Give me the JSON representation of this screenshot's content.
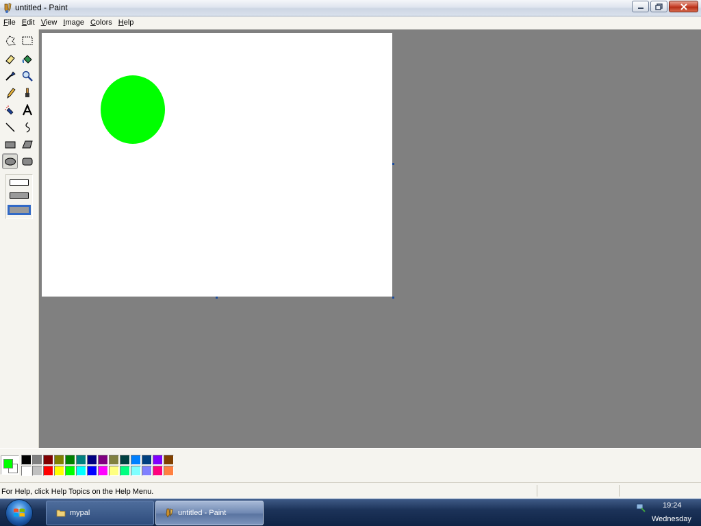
{
  "window": {
    "title": "untitled - Paint"
  },
  "menu": [
    {
      "u": "F",
      "rest": "ile"
    },
    {
      "u": "E",
      "rest": "dit"
    },
    {
      "u": "V",
      "rest": "iew"
    },
    {
      "u": "I",
      "rest": "mage"
    },
    {
      "u": "C",
      "rest": "olors"
    },
    {
      "u": "H",
      "rest": "elp"
    }
  ],
  "tools": [
    {
      "name": "free-form-select-tool",
      "icon": "free-form-select-icon",
      "selected": false
    },
    {
      "name": "select-tool",
      "icon": "select-icon",
      "selected": false
    },
    {
      "name": "eraser-tool",
      "icon": "eraser-icon",
      "selected": false
    },
    {
      "name": "fill-tool",
      "icon": "paint-bucket-icon",
      "selected": false
    },
    {
      "name": "pick-color-tool",
      "icon": "eyedropper-icon",
      "selected": false
    },
    {
      "name": "magnifier-tool",
      "icon": "magnifier-icon",
      "selected": false
    },
    {
      "name": "pencil-tool",
      "icon": "pencil-icon",
      "selected": false
    },
    {
      "name": "brush-tool",
      "icon": "brush-icon",
      "selected": false
    },
    {
      "name": "airbrush-tool",
      "icon": "airbrush-icon",
      "selected": false
    },
    {
      "name": "text-tool",
      "icon": "text-icon",
      "selected": false
    },
    {
      "name": "line-tool",
      "icon": "line-icon",
      "selected": false
    },
    {
      "name": "curve-tool",
      "icon": "curve-icon",
      "selected": false
    },
    {
      "name": "rectangle-tool",
      "icon": "rectangle-icon",
      "selected": false
    },
    {
      "name": "polygon-tool",
      "icon": "polygon-icon",
      "selected": false
    },
    {
      "name": "ellipse-tool",
      "icon": "ellipse-icon",
      "selected": true
    },
    {
      "name": "rounded-rectangle-tool",
      "icon": "rounded-rectangle-icon",
      "selected": false
    }
  ],
  "fill_options": [
    {
      "name": "outline-option",
      "style": "outline",
      "selected": false
    },
    {
      "name": "outline-fill-option",
      "style": "outline-fill",
      "selected": false
    },
    {
      "name": "fill-only-option",
      "style": "fill",
      "selected": true
    }
  ],
  "canvas": {
    "ellipse_color": "#00ff00"
  },
  "colors": {
    "foreground": "#00ff00",
    "background": "#ffffff",
    "palette": [
      "#000000",
      "#808080",
      "#800000",
      "#808000",
      "#008000",
      "#008080",
      "#000080",
      "#800080",
      "#808040",
      "#004040",
      "#0080ff",
      "#004080",
      "#8000ff",
      "#804000",
      "#ffffff",
      "#c0c0c0",
      "#ff0000",
      "#ffff00",
      "#00ff00",
      "#00ffff",
      "#0000ff",
      "#ff00ff",
      "#ffff80",
      "#00ff80",
      "#80ffff",
      "#8080ff",
      "#ff0080",
      "#ff8040"
    ]
  },
  "status": {
    "text": "For Help, click Help Topics on the Help Menu."
  },
  "taskbar": {
    "items": [
      {
        "label": "mypal",
        "icon": "folder-icon",
        "active": false
      },
      {
        "label": "untitled - Paint",
        "icon": "paint-icon",
        "active": true
      }
    ],
    "clock": {
      "time": "19:24",
      "day": "Wednesday"
    }
  }
}
